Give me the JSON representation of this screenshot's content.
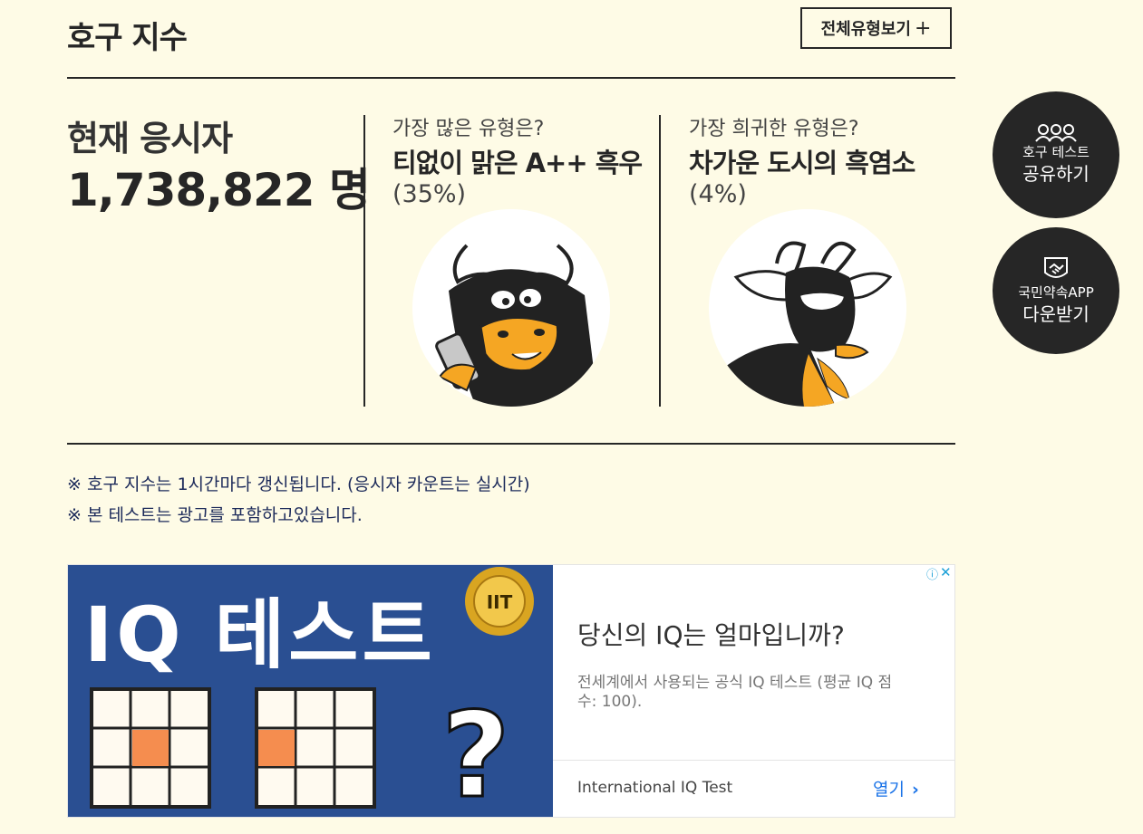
{
  "header": {
    "title": "호구 지수",
    "all_types_label": "전체유형보기",
    "all_types_plus": "+"
  },
  "stats": {
    "count_label": "현재 응시자",
    "count_value": "1,738,822 명",
    "most": {
      "question": "가장 많은 유형은?",
      "name": "티없이 맑은 A++ 흑우",
      "percent": "(35%)"
    },
    "rarest": {
      "question": "가장 희귀한 유형은?",
      "name": "차가운 도시의 흑염소",
      "percent": "(4%)"
    }
  },
  "notes": {
    "line1": "※ 호구 지수는 1시간마다 갱신됩니다. (응시자 카운트는 실시간)",
    "line2": "※ 본 테스트는 광고를 포함하고있습니다."
  },
  "side": {
    "share_line1": "호구 테스트",
    "share_line2": "공유하기",
    "app_line1": "국민약속APP",
    "app_line2": "다운받기"
  },
  "ad": {
    "image_title": "IQ 테스트",
    "badge": "IIT",
    "question_mark": "?",
    "headline": "당신의 IQ는 얼마입니까?",
    "description": "전세계에서 사용되는 공식 IQ 테스트 (평균 IQ 점수: 100).",
    "advertiser": "International IQ Test",
    "open_label": "열기",
    "open_chevron": "›",
    "choices": "ⓘ",
    "close": "✕",
    "colors": {
      "background": "#2a4f92",
      "cell_highlight": "#f58d4f",
      "badge": "#d9a521"
    }
  },
  "icons": {
    "share": "people-icon",
    "app": "handshake-icon",
    "most_type": "bull-character",
    "rarest_type": "goat-character"
  },
  "colors": {
    "page_background": "#fefbe6",
    "text": "#262626",
    "note_text": "#1c2a5a",
    "accent_orange": "#f5a623"
  }
}
